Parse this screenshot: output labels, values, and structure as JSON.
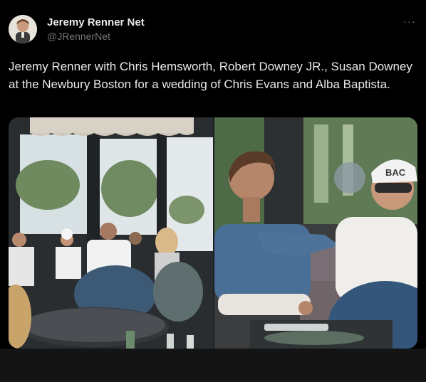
{
  "author": {
    "display_name": "Jeremy Renner Net",
    "handle": "@JRennerNet",
    "avatar_icon": "profile-avatar"
  },
  "menu": {
    "more_label": "···"
  },
  "tweet": {
    "text": "Jeremy Renner with Chris Hemsworth, Robert Downey JR., Susan Downey at the Newbury Boston for a wedding of Chris Evans and Alba Baptista."
  },
  "media": {
    "images": [
      {
        "id": "left-photo"
      },
      {
        "id": "right-photo",
        "cap_text": "BAC"
      }
    ]
  },
  "colors": {
    "background": "#000000",
    "text": "#e7e9ea",
    "secondary": "#71767b"
  }
}
